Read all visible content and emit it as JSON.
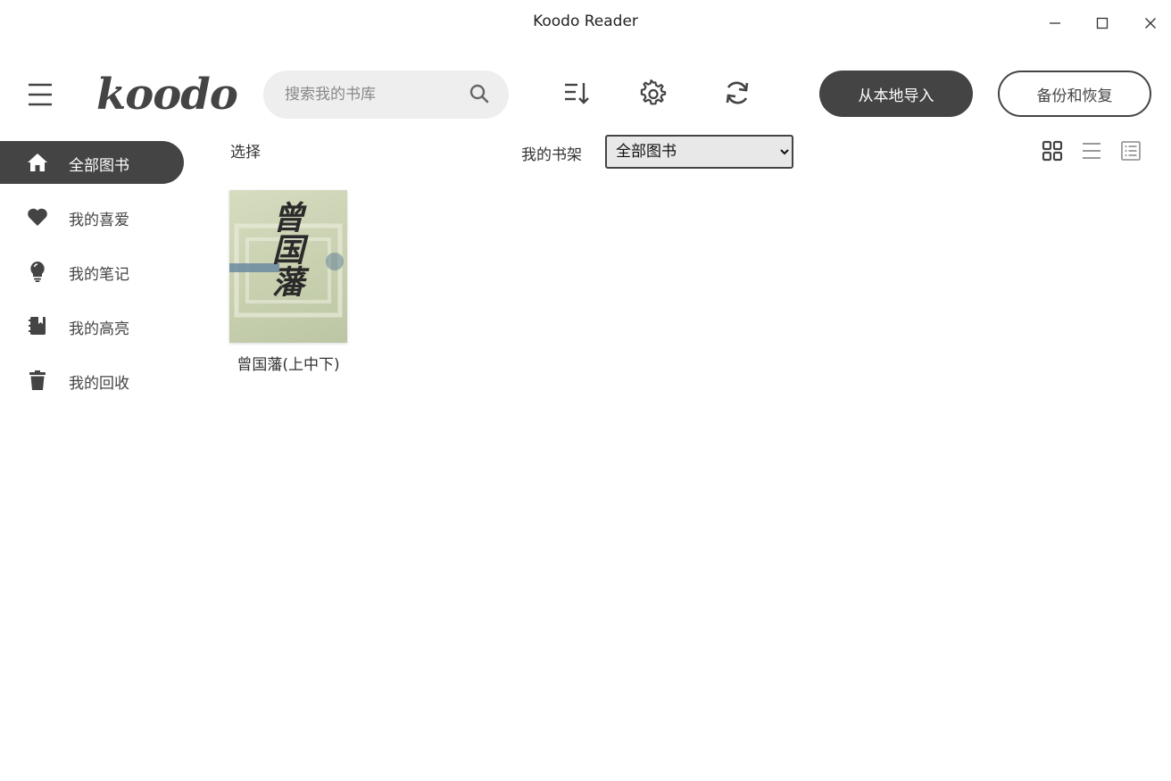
{
  "window": {
    "title": "Koodo Reader"
  },
  "header": {
    "logo_text": "koodo",
    "search_placeholder": "搜索我的书库",
    "import_label": "从本地导入",
    "backup_label": "备份和恢复"
  },
  "sidebar": {
    "items": [
      {
        "label": "全部图书",
        "icon": "home-icon",
        "active": true
      },
      {
        "label": "我的喜爱",
        "icon": "heart-icon",
        "active": false
      },
      {
        "label": "我的笔记",
        "icon": "lightbulb-icon",
        "active": false
      },
      {
        "label": "我的高亮",
        "icon": "bookmark-book-icon",
        "active": false
      },
      {
        "label": "我的回收",
        "icon": "trash-icon",
        "active": false
      }
    ]
  },
  "toolbar": {
    "select_label": "选择",
    "shelf_label": "我的书架",
    "shelf_selected": "全部图书"
  },
  "books": [
    {
      "title": "曾国藩(上中下)",
      "cover_text": "曾国藩"
    }
  ],
  "colors": {
    "accent": "#444444",
    "cover": "#c9d1b1"
  }
}
